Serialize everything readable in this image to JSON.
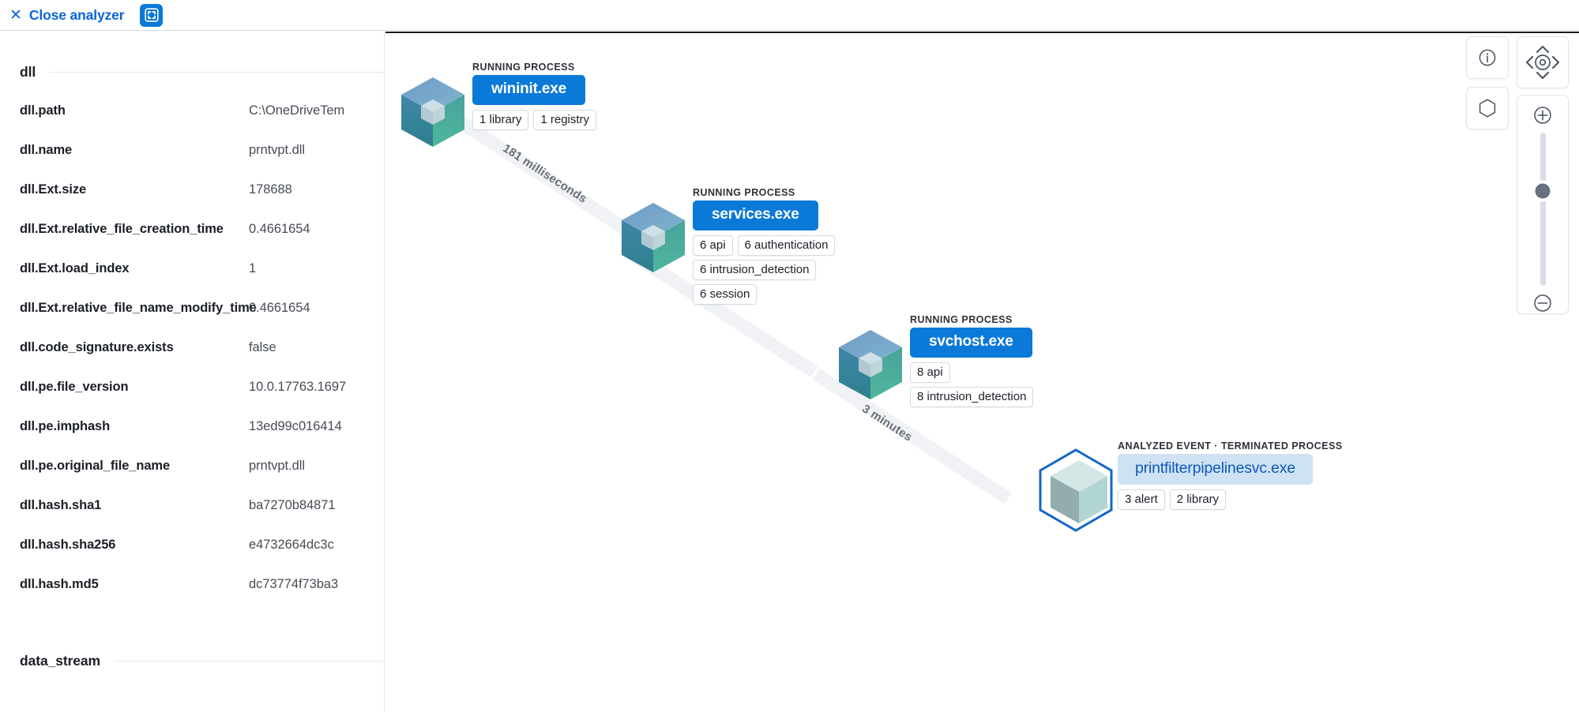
{
  "topbar": {
    "close_icon": "close-x-icon",
    "close_label": "Close analyzer",
    "fullscreen_icon": "fullscreen-expand-icon"
  },
  "details_panel": {
    "sections": [
      {
        "title": "dll"
      },
      {
        "title": "data_stream"
      }
    ],
    "fields": [
      {
        "key": "dll.path",
        "value": "C:\\OneDriveTem"
      },
      {
        "key": "dll.name",
        "value": "prntvpt.dll"
      },
      {
        "key": "dll.Ext.size",
        "value": "178688"
      },
      {
        "key": "dll.Ext.relative_file_creation_time",
        "value": "0.4661654"
      },
      {
        "key": "dll.Ext.load_index",
        "value": "1"
      },
      {
        "key": "dll.Ext.relative_file_name_modify_time",
        "value": "0.4661654"
      },
      {
        "key": "dll.code_signature.exists",
        "value": "false"
      },
      {
        "key": "dll.pe.file_version",
        "value": "10.0.17763.1697"
      },
      {
        "key": "dll.pe.imphash",
        "value": "13ed99c016414"
      },
      {
        "key": "dll.pe.original_file_name",
        "value": "prntvpt.dll"
      },
      {
        "key": "dll.hash.sha1",
        "value": "ba7270b84871"
      },
      {
        "key": "dll.hash.sha256",
        "value": "e4732664dc3c"
      },
      {
        "key": "dll.hash.md5",
        "value": "dc73774f73ba3"
      }
    ]
  },
  "graph": {
    "nodes": [
      {
        "id": "wininit",
        "kind": "RUNNING PROCESS",
        "name": "wininit.exe",
        "state": "running",
        "badges": [
          [
            "1 library",
            "1 registry"
          ]
        ]
      },
      {
        "id": "services",
        "kind": "RUNNING PROCESS",
        "name": "services.exe",
        "state": "running",
        "badges": [
          [
            "6 api",
            "6 authentication"
          ],
          [
            "6 intrusion_detection"
          ],
          [
            "6 session"
          ]
        ]
      },
      {
        "id": "svchost",
        "kind": "RUNNING PROCESS",
        "name": "svchost.exe",
        "state": "running",
        "badges": [
          [
            "8 api"
          ],
          [
            "8 intrusion_detection"
          ]
        ]
      },
      {
        "id": "printfilter",
        "kind": "ANALYZED EVENT · TERMINATED PROCESS",
        "name": "printfilterpipelinesvc.exe",
        "state": "analyzed",
        "badges": [
          [
            "3 alert",
            "2 library"
          ]
        ]
      }
    ],
    "edges": [
      {
        "from": "wininit",
        "to": "services",
        "label": "181 milliseconds"
      },
      {
        "from": "services",
        "to": "svchost",
        "label": ""
      },
      {
        "from": "svchost",
        "to": "printfilter",
        "label": "3 minutes"
      }
    ]
  },
  "controls": {
    "info_icon": "info-circle-icon",
    "hexagon_icon": "hexagon-outline-icon",
    "pan_up_icon": "chevron-up-icon",
    "pan_down_icon": "chevron-down-icon",
    "pan_left_icon": "chevron-left-icon",
    "pan_right_icon": "chevron-right-icon",
    "center_icon": "crosshair-target-icon",
    "zoom_in_icon": "plus-circle-icon",
    "zoom_out_icon": "minus-circle-icon",
    "zoom_slider_value": 62
  },
  "colors": {
    "accent_blue": "#0b79d8",
    "link_blue": "#0b64dd",
    "analyzed_pill_bg": "#cfe2f3",
    "analyzed_pill_text": "#1058b8",
    "edge_gray": "#f0f2f6",
    "text_dark": "#1b1f26",
    "text_muted": "#474c55"
  }
}
